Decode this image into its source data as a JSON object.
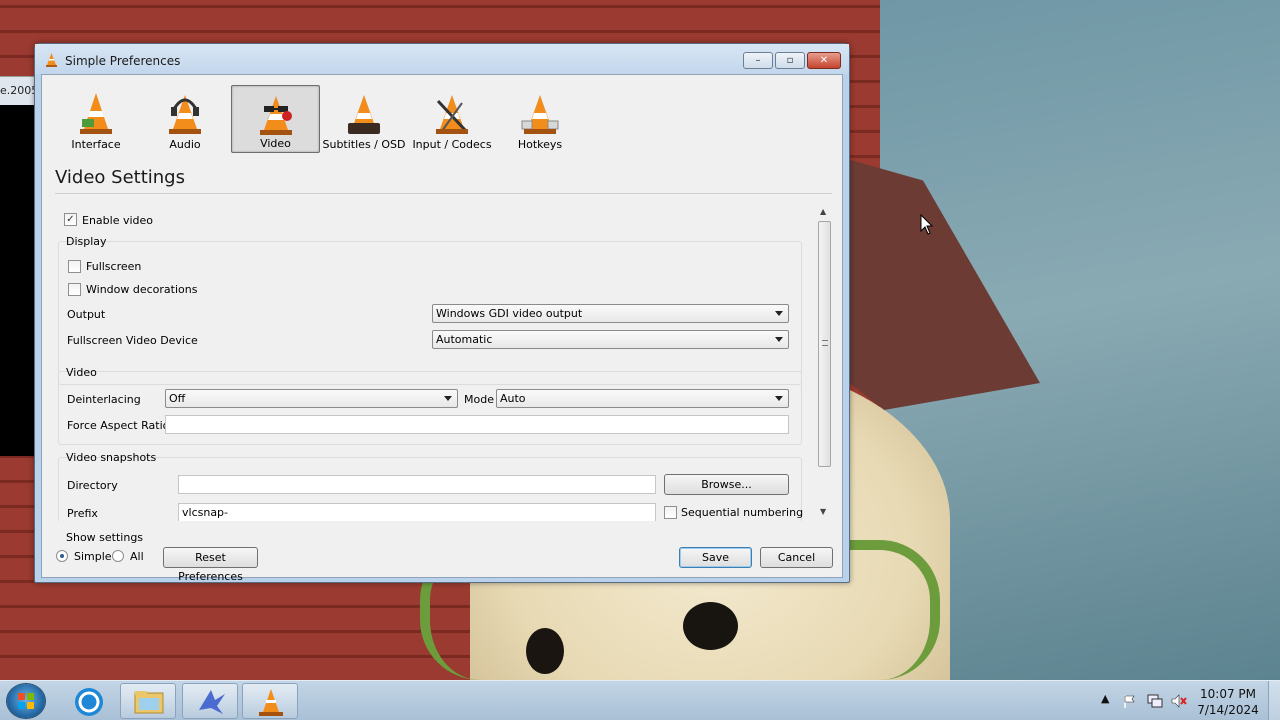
{
  "background_window": {
    "title_fragment": "e.2005"
  },
  "dialog": {
    "title": "Simple Preferences",
    "window_buttons": {
      "minimize": "–",
      "maximize": "▫",
      "close": "✕"
    }
  },
  "categories": [
    {
      "label": "Interface",
      "icon": "interface-cone-icon",
      "selected": false
    },
    {
      "label": "Audio",
      "icon": "audio-headphones-cone-icon",
      "selected": false
    },
    {
      "label": "Video",
      "icon": "video-glasses-cone-icon",
      "selected": true
    },
    {
      "label": "Subtitles / OSD",
      "icon": "subtitles-cone-icon",
      "selected": false
    },
    {
      "label": "Input / Codecs",
      "icon": "input-codecs-cone-icon",
      "selected": false
    },
    {
      "label": "Hotkeys",
      "icon": "hotkeys-cone-icon",
      "selected": false
    }
  ],
  "page_title": "Video Settings",
  "settings": {
    "enable_video": {
      "label": "Enable video",
      "checked": true
    },
    "display": {
      "title": "Display",
      "fullscreen": {
        "label": "Fullscreen",
        "checked": false
      },
      "window_decorations": {
        "label": "Window decorations",
        "checked": false
      },
      "output": {
        "label": "Output",
        "value": "Windows GDI video output"
      },
      "fullscreen_device": {
        "label": "Fullscreen Video Device",
        "value": "Automatic"
      }
    },
    "video": {
      "title": "Video",
      "deinterlacing": {
        "label": "Deinterlacing",
        "value": "Off"
      },
      "mode": {
        "label": "Mode",
        "value": "Auto"
      },
      "force_aspect_ratio": {
        "label": "Force Aspect Ratio",
        "value": ""
      }
    },
    "snapshots": {
      "title": "Video snapshots",
      "directory": {
        "label": "Directory",
        "value": ""
      },
      "browse_button": "Browse...",
      "prefix": {
        "label": "Prefix",
        "value": "vlcsnap-"
      },
      "sequential_numbering": {
        "label": "Sequential numbering",
        "checked": false
      }
    }
  },
  "footer": {
    "show_settings_label": "Show settings",
    "simple_label": "Simple",
    "all_label": "All",
    "selected_mode": "Simple",
    "reset_button": "Reset Preferences",
    "save_button": "Save",
    "cancel_button": "Cancel"
  },
  "taskbar": {
    "pinned": [
      "start-orb-icon",
      "ie-icon",
      "explorer-folder-icon",
      "app-bird-icon",
      "vlc-cone-icon"
    ],
    "tray_icons": [
      "show-hidden-icons-arrow",
      "action-center-flag-icon",
      "network-icon",
      "volume-muted-icon"
    ],
    "clock": {
      "time": "10:07 PM",
      "date": "7/14/2024"
    }
  },
  "colors": {
    "vlc_orange": "#f28c1b",
    "selection_gray": "#dcdcdc",
    "titlebar_blue": "#c2d6ec"
  }
}
